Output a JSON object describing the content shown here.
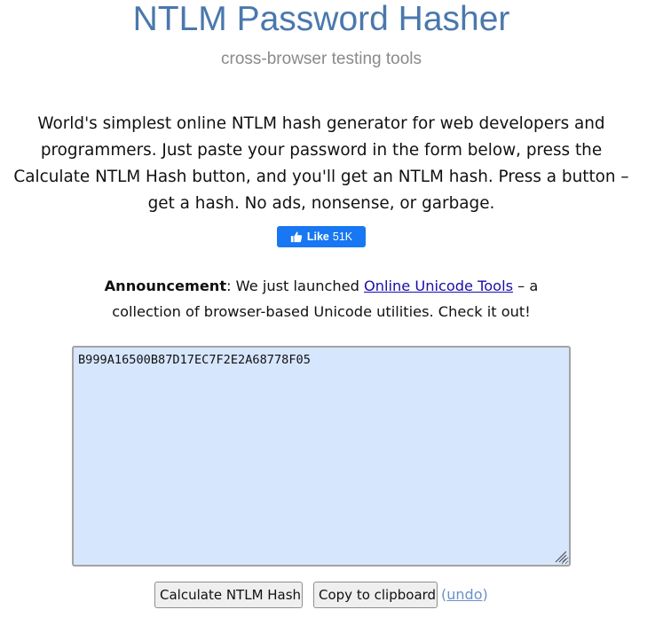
{
  "header": {
    "title": "NTLM Password Hasher",
    "subtitle": "cross-browser testing tools"
  },
  "intro": {
    "lines": [
      "World's simplest online NTLM hash generator for web developers and",
      "programmers. Just paste your password in the form below, press the",
      "Calculate NTLM Hash button, and you'll get an NTLM hash. Press a button –",
      "get a hash. No ads, nonsense, or garbage."
    ]
  },
  "like_button": {
    "label": "Like",
    "count": "51K",
    "icon": "thumbs-up-icon",
    "color": "#1877f2"
  },
  "announcement": {
    "bold": "Announcement",
    "text_before_link": ": We just launched ",
    "link_text": "Online Unicode Tools",
    "text_after_link": " – a",
    "line2": "collection of browser-based Unicode utilities. Check it out!"
  },
  "editor": {
    "value": "B999A16500B87D17EC7F2E2A68778F05",
    "background": "#d6e6fd"
  },
  "actions": {
    "calculate_label": "Calculate NTLM Hash",
    "copy_label": "Copy to clipboard",
    "undo_open": "(",
    "undo_label": "undo",
    "undo_close": ")"
  },
  "colors": {
    "title": "#4a78ad",
    "subtitle": "#8a8a8a",
    "link": "#1a0dab",
    "undo": "#6a90c9"
  }
}
